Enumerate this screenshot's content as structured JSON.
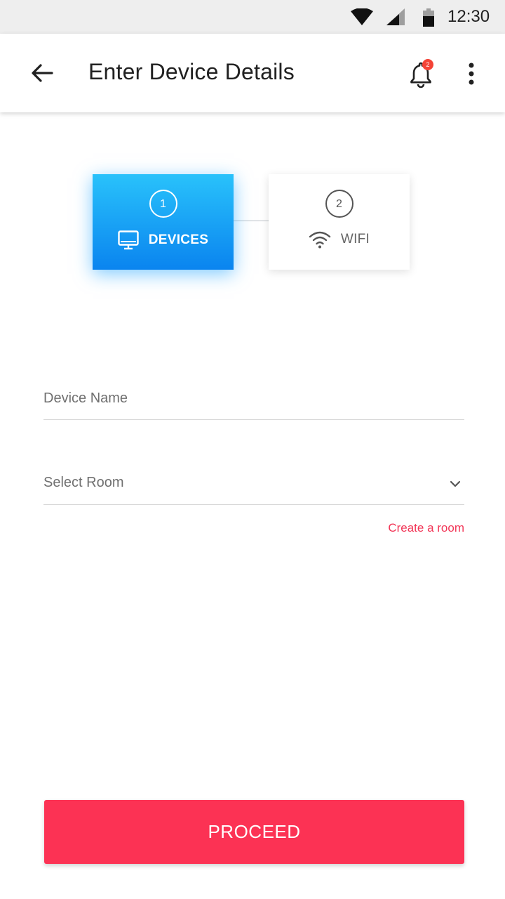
{
  "status_bar": {
    "time": "12:30",
    "icons": [
      "wifi-icon",
      "cell-signal-icon",
      "battery-icon"
    ]
  },
  "app_bar": {
    "title": "Enter Device Details",
    "notification_count": "2",
    "icons": [
      "back-arrow-icon",
      "bell-icon",
      "more-vert-icon"
    ]
  },
  "stepper": {
    "steps": [
      {
        "number": "1",
        "label": "DEVICES",
        "icon": "monitor-icon",
        "active": true
      },
      {
        "number": "2",
        "label": "WIFI",
        "icon": "wifi-icon",
        "active": false
      }
    ]
  },
  "form": {
    "device_name_placeholder": "Device Name",
    "room_placeholder": "Select Room",
    "create_room_link": "Create a room"
  },
  "proceed_label": "PROCEED",
  "colors": {
    "accent": "#fc3254",
    "link": "#f23657",
    "active_step_top": "#29c2fb",
    "active_step_bottom": "#0a84ef",
    "badge": "#f44336"
  }
}
